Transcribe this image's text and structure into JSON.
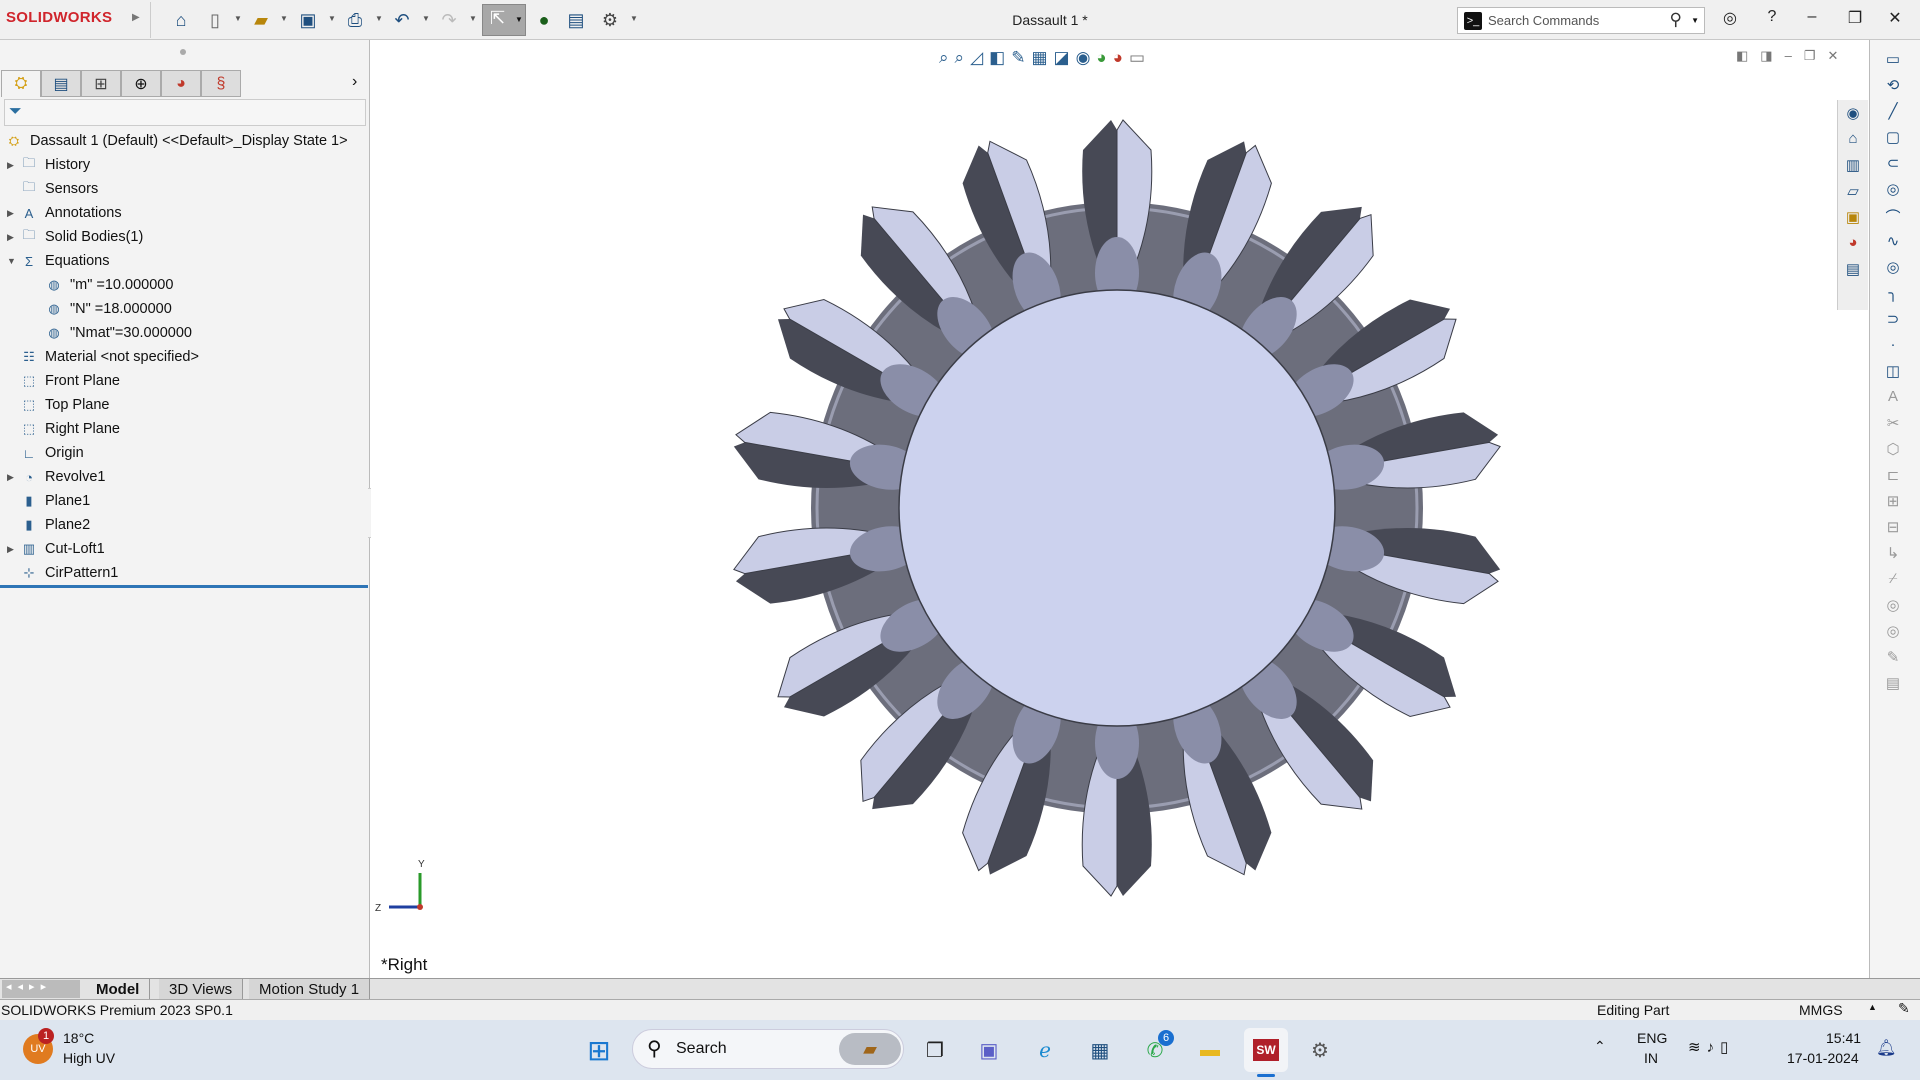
{
  "app": {
    "logo": "SOLIDWORKS",
    "title": "Dassault 1 *",
    "search_placeholder": "Search Commands"
  },
  "toolbar": {
    "icons": [
      "home-icon",
      "new-document-icon",
      "open-icon",
      "save-icon",
      "print-icon",
      "undo-icon",
      "redo-icon",
      "select-icon",
      "traffic-light-icon",
      "file-properties-icon",
      "options-gear-icon"
    ]
  },
  "tree": {
    "root": "Dassault 1 (Default) <<Default>_Display State 1>",
    "items": [
      {
        "label": "History",
        "expandable": true,
        "icon": "history-folder-icon"
      },
      {
        "label": "Sensors",
        "expandable": false,
        "icon": "sensors-folder-icon"
      },
      {
        "label": "Annotations",
        "expandable": true,
        "icon": "annotations-folder-icon"
      },
      {
        "label": "Solid Bodies(1)",
        "expandable": true,
        "icon": "solid-bodies-folder-icon"
      },
      {
        "label": "Equations",
        "expandable": true,
        "expanded": true,
        "icon": "equations-folder-icon"
      },
      {
        "label": "\"m\" =10.000000",
        "indent": 2,
        "icon": "global-variable-icon"
      },
      {
        "label": "\"N\" =18.000000",
        "indent": 2,
        "icon": "global-variable-icon"
      },
      {
        "label": "\"Nmat\"=30.000000",
        "indent": 2,
        "icon": "global-variable-icon"
      },
      {
        "label": "Material <not specified>",
        "icon": "material-icon"
      },
      {
        "label": "Front Plane",
        "icon": "plane-icon"
      },
      {
        "label": "Top Plane",
        "icon": "plane-icon"
      },
      {
        "label": "Right Plane",
        "icon": "plane-icon"
      },
      {
        "label": "Origin",
        "icon": "origin-icon"
      },
      {
        "label": "Revolve1",
        "expandable": true,
        "icon": "revolve-icon"
      },
      {
        "label": "Plane1",
        "icon": "ref-plane-icon"
      },
      {
        "label": "Plane2",
        "icon": "ref-plane-icon"
      },
      {
        "label": "Cut-Loft1",
        "expandable": true,
        "icon": "cut-loft-icon"
      },
      {
        "label": "CirPattern1",
        "icon": "circular-pattern-icon"
      }
    ]
  },
  "viewport": {
    "view_label": "*Right",
    "triad": {
      "y": "Y",
      "z": "Z"
    }
  },
  "bottom_tabs": [
    "Model",
    "3D Views",
    "Motion Study 1"
  ],
  "status": {
    "product": "SOLIDWORKS Premium 2023 SP0.1",
    "mode": "Editing Part",
    "units": "MMGS"
  },
  "taskbar": {
    "weather_temp": "18°C",
    "weather_desc": "High UV",
    "weather_badge": "1",
    "weather_icon_text": "UV",
    "search": "Search",
    "whatsapp_badge": "6",
    "lang": "ENG",
    "region": "IN",
    "time": "15:41",
    "date": "17-01-2024"
  },
  "colors": {
    "brand": "#d0252c",
    "selection": "#2e75b6",
    "gear_light": "#c9cde6",
    "gear_dark": "#474955"
  }
}
